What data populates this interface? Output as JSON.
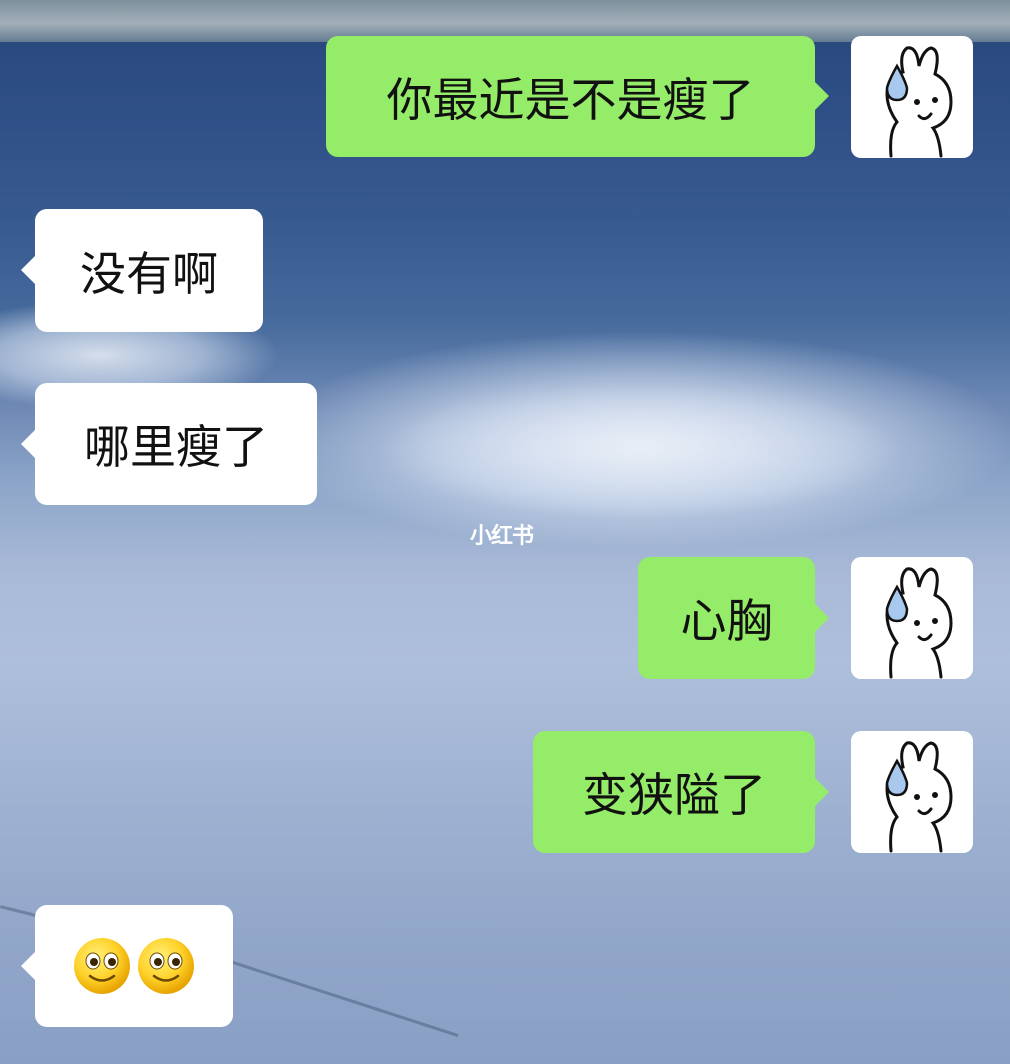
{
  "watermark": "小红书",
  "colors": {
    "sent_bubble": "#95ec69",
    "received_bubble": "#ffffff",
    "text": "#111111"
  },
  "avatar": {
    "icon": "bunny-sweat-drop-icon"
  },
  "messages": [
    {
      "side": "sent",
      "text": "你最近是不是瘦了"
    },
    {
      "side": "received",
      "text": "没有啊"
    },
    {
      "side": "received",
      "text": "哪里瘦了"
    },
    {
      "side": "sent",
      "text": "心胸"
    },
    {
      "side": "sent",
      "text": "变狭隘了"
    },
    {
      "side": "received",
      "emoji": [
        "slightly-smiling-face",
        "slightly-smiling-face"
      ]
    }
  ]
}
